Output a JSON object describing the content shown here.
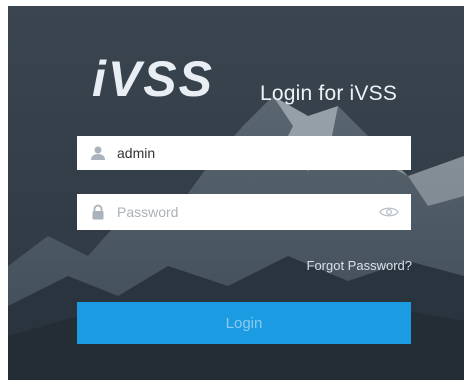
{
  "brand": {
    "logo_text": "iVSS",
    "login_for": "Login for iVSS"
  },
  "form": {
    "username_value": "admin",
    "username_icon": "user-icon",
    "password_placeholder": "Password",
    "password_icon": "lock-icon",
    "visibility_icon": "eye-icon",
    "forgot_password": "Forgot Password?",
    "login_label": "Login"
  },
  "colors": {
    "background": "#2f3a45",
    "login_button": "#1a9be2",
    "login_button_text": "#8ccaf0"
  }
}
